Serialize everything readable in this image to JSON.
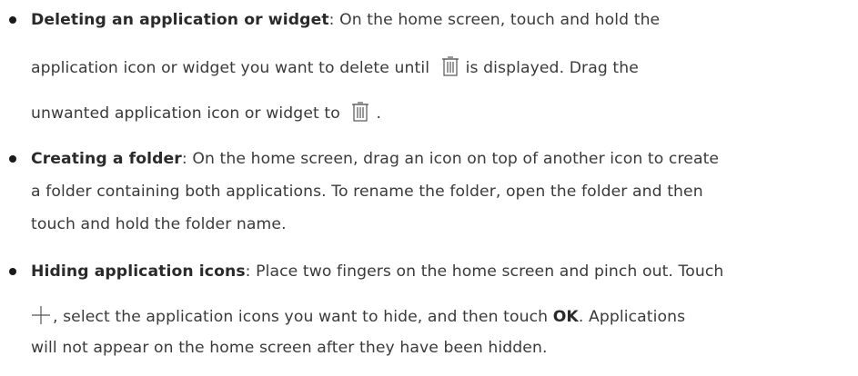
{
  "items": [
    {
      "title": "Deleting an application or widget",
      "line1_rest": ": On the home screen, touch and hold the",
      "line2_a": "application icon or widget you want to delete until",
      "line2_b": "is displayed. Drag the",
      "line3_a": "unwanted application icon or widget to",
      "line3_b": "."
    },
    {
      "title": "Creating a folder",
      "line1_rest": ": On the home screen, drag an icon on top of another icon to create",
      "line2": "a folder containing both applications. To rename the folder, open the folder and then",
      "line3": "touch and hold the folder name."
    },
    {
      "title": "Hiding application icons",
      "line1_rest": ": Place two fingers on the home screen and pinch out. Touch",
      "line2_a": ", select the application icons you want to hide, and then touch",
      "line2_ok": "OK",
      "line2_b": ". Applications",
      "line3": "will not appear on the home screen after they have been hidden."
    }
  ],
  "icons": {
    "delete": "trash-can-icon",
    "add": "plus-icon"
  }
}
